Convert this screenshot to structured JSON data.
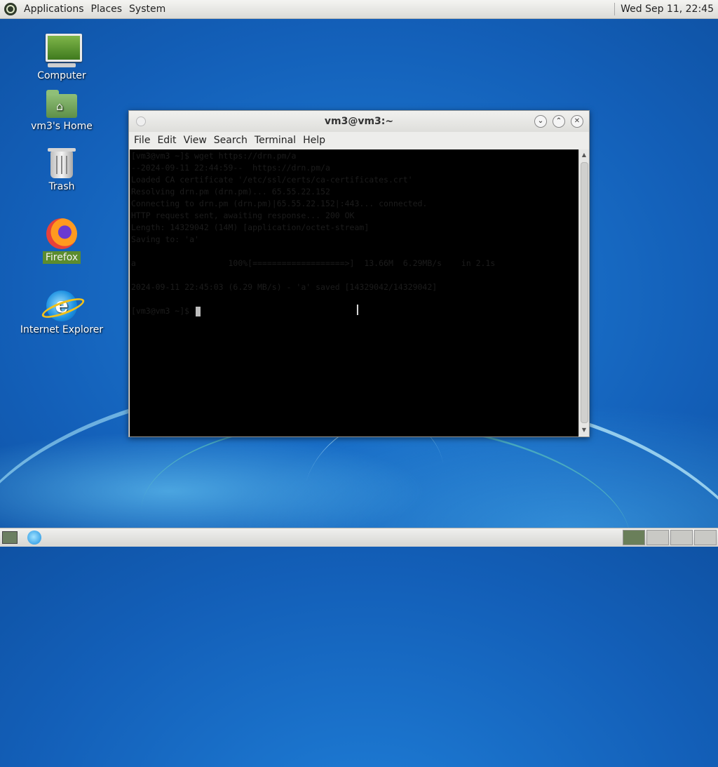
{
  "top_panel": {
    "menus": [
      "Applications",
      "Places",
      "System"
    ],
    "clock": "Wed Sep 11, 22:45"
  },
  "desktop": {
    "icons": [
      {
        "label": "Computer",
        "icon": "computer-icon"
      },
      {
        "label": "vm3's Home",
        "icon": "home-folder-icon"
      },
      {
        "label": "Trash",
        "icon": "trash-icon"
      },
      {
        "label": "Firefox",
        "icon": "firefox-icon",
        "selected": true
      },
      {
        "label": "Internet Explorer",
        "icon": "internet-explorer-icon"
      }
    ]
  },
  "terminal": {
    "title": "vm3@vm3:~",
    "menu": [
      "File",
      "Edit",
      "View",
      "Search",
      "Terminal",
      "Help"
    ],
    "lines": [
      "[vm3@vm3 ~]$ wget https://drn.pm/a",
      "--2024-09-11 22:44:59--  https://drn.pm/a",
      "Loaded CA certificate '/etc/ssl/certs/ca-certificates.crt'",
      "Resolving drn.pm (drn.pm)... 65.55.22.152",
      "Connecting to drn.pm (drn.pm)|65.55.22.152|:443... connected.",
      "HTTP request sent, awaiting response... 200 OK",
      "Length: 14329042 (14M) [application/octet-stream]",
      "Saving to: 'a'",
      "",
      "a                   100%[===================>]  13.66M  6.29MB/s    in 2.1s",
      "",
      "2024-09-11 22:45:03 (6.29 MB/s) - 'a' saved [14329042/14329042]",
      "",
      "[vm3@vm3 ~]$ "
    ]
  },
  "colors": {
    "desktop_bg": "#135fb8",
    "terminal_bg": "#000000",
    "selected_label_bg": "#5c8c2e"
  }
}
